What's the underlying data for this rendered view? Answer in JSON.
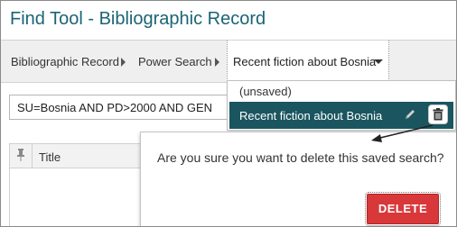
{
  "window": {
    "title": "Find Tool - Bibliographic Record"
  },
  "breadcrumb": {
    "items": [
      "Bibliographic Record",
      "Power Search"
    ],
    "current": "Recent fiction about Bosnia"
  },
  "search": {
    "query": "SU=Bosnia AND PD>2000 AND GEN"
  },
  "table": {
    "columns": [
      "Title"
    ]
  },
  "saved_searches_dropdown": {
    "options": [
      "(unsaved)",
      "Recent fiction about Bosnia"
    ],
    "selected": "Recent fiction about Bosnia"
  },
  "confirm_dialog": {
    "message": "Are you sure you want to delete this saved search?",
    "delete_label": "DELETE"
  },
  "colors": {
    "title": "#1b6474",
    "selected_row": "#1a5560",
    "delete_button": "#d8383a"
  },
  "icons": [
    "chevron-right-icon",
    "caret-down-icon",
    "pin-icon",
    "pencil-icon",
    "trash-icon"
  ]
}
